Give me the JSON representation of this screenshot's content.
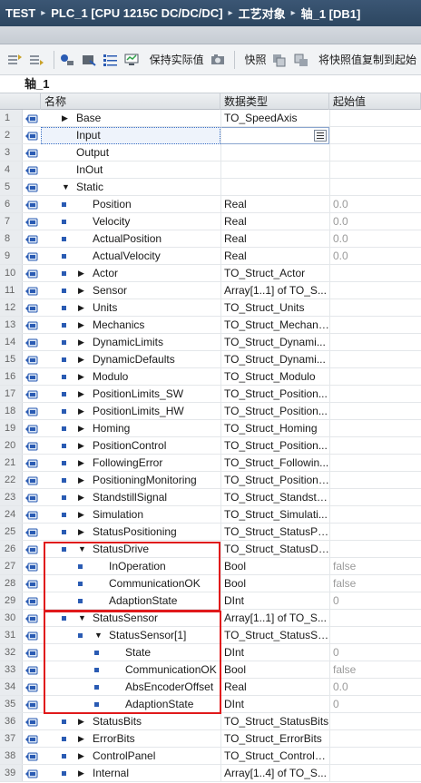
{
  "breadcrumb": {
    "project": "TEST",
    "plc": "PLC_1 [CPU 1215C DC/DC/DC]",
    "folder": "工艺对象",
    "block": "轴_1 [DB1]",
    "separator": "▸"
  },
  "toolbar": {
    "keep_actual": "保持实际值",
    "snapshot": "快照",
    "copy_snapshot": "将快照值复制到起始"
  },
  "block_title": "轴_1",
  "columns": {
    "name": "名称",
    "datatype": "数据类型",
    "start": "起始值"
  },
  "rows": [
    {
      "n": "1",
      "name": "Base",
      "type": "TO_SpeedAxis",
      "val": "",
      "arrow": "right",
      "dot": false,
      "indent": 0
    },
    {
      "n": "2",
      "name": "Input",
      "type": "",
      "val": "",
      "arrow": "none",
      "dot": false,
      "indent": 0
    },
    {
      "n": "3",
      "name": "Output",
      "type": "",
      "val": "",
      "arrow": "none",
      "dot": false,
      "indent": 0
    },
    {
      "n": "4",
      "name": "InOut",
      "type": "",
      "val": "",
      "arrow": "none",
      "dot": false,
      "indent": 0
    },
    {
      "n": "5",
      "name": "Static",
      "type": "",
      "val": "",
      "arrow": "down",
      "dot": false,
      "indent": 0
    },
    {
      "n": "6",
      "name": "Position",
      "type": "Real",
      "val": "0.0",
      "arrow": "none",
      "dot": true,
      "indent": 1
    },
    {
      "n": "7",
      "name": "Velocity",
      "type": "Real",
      "val": "0.0",
      "arrow": "none",
      "dot": true,
      "indent": 1
    },
    {
      "n": "8",
      "name": "ActualPosition",
      "type": "Real",
      "val": "0.0",
      "arrow": "none",
      "dot": true,
      "indent": 1
    },
    {
      "n": "9",
      "name": "ActualVelocity",
      "type": "Real",
      "val": "0.0",
      "arrow": "none",
      "dot": true,
      "indent": 1
    },
    {
      "n": "10",
      "name": "Actor",
      "type": "TO_Struct_Actor",
      "val": "",
      "arrow": "right",
      "dot": true,
      "indent": 1
    },
    {
      "n": "11",
      "name": "Sensor",
      "type": "Array[1..1] of TO_S...",
      "val": "",
      "arrow": "right",
      "dot": true,
      "indent": 1
    },
    {
      "n": "12",
      "name": "Units",
      "type": "TO_Struct_Units",
      "val": "",
      "arrow": "right",
      "dot": true,
      "indent": 1
    },
    {
      "n": "13",
      "name": "Mechanics",
      "type": "TO_Struct_Mechani...",
      "val": "",
      "arrow": "right",
      "dot": true,
      "indent": 1
    },
    {
      "n": "14",
      "name": "DynamicLimits",
      "type": "TO_Struct_Dynami...",
      "val": "",
      "arrow": "right",
      "dot": true,
      "indent": 1
    },
    {
      "n": "15",
      "name": "DynamicDefaults",
      "type": "TO_Struct_Dynami...",
      "val": "",
      "arrow": "right",
      "dot": true,
      "indent": 1
    },
    {
      "n": "16",
      "name": "Modulo",
      "type": "TO_Struct_Modulo",
      "val": "",
      "arrow": "right",
      "dot": true,
      "indent": 1
    },
    {
      "n": "17",
      "name": "PositionLimits_SW",
      "type": "TO_Struct_Position...",
      "val": "",
      "arrow": "right",
      "dot": true,
      "indent": 1
    },
    {
      "n": "18",
      "name": "PositionLimits_HW",
      "type": "TO_Struct_Position...",
      "val": "",
      "arrow": "right",
      "dot": true,
      "indent": 1
    },
    {
      "n": "19",
      "name": "Homing",
      "type": "TO_Struct_Homing",
      "val": "",
      "arrow": "right",
      "dot": true,
      "indent": 1
    },
    {
      "n": "20",
      "name": "PositionControl",
      "type": "TO_Struct_Position...",
      "val": "",
      "arrow": "right",
      "dot": true,
      "indent": 1
    },
    {
      "n": "21",
      "name": "FollowingError",
      "type": "TO_Struct_Followin...",
      "val": "",
      "arrow": "right",
      "dot": true,
      "indent": 1
    },
    {
      "n": "22",
      "name": "PositioningMonitoring",
      "type": "TO_Struct_Positioni...",
      "val": "",
      "arrow": "right",
      "dot": true,
      "indent": 1
    },
    {
      "n": "23",
      "name": "StandstillSignal",
      "type": "TO_Struct_Standstil...",
      "val": "",
      "arrow": "right",
      "dot": true,
      "indent": 1
    },
    {
      "n": "24",
      "name": "Simulation",
      "type": "TO_Struct_Simulati...",
      "val": "",
      "arrow": "right",
      "dot": true,
      "indent": 1
    },
    {
      "n": "25",
      "name": "StatusPositioning",
      "type": "TO_Struct_StatusPo...",
      "val": "",
      "arrow": "right",
      "dot": true,
      "indent": 1
    },
    {
      "n": "26",
      "name": "StatusDrive",
      "type": "TO_Struct_StatusDr...",
      "val": "",
      "arrow": "down",
      "dot": true,
      "indent": 1
    },
    {
      "n": "27",
      "name": "InOperation",
      "type": "Bool",
      "val": "false",
      "arrow": "none",
      "dot": true,
      "indent": 2
    },
    {
      "n": "28",
      "name": "CommunicationOK",
      "type": "Bool",
      "val": "false",
      "arrow": "none",
      "dot": true,
      "indent": 2
    },
    {
      "n": "29",
      "name": "AdaptionState",
      "type": "DInt",
      "val": "0",
      "arrow": "none",
      "dot": true,
      "indent": 2
    },
    {
      "n": "30",
      "name": "StatusSensor",
      "type": "Array[1..1] of TO_S...",
      "val": "",
      "arrow": "down",
      "dot": true,
      "indent": 1
    },
    {
      "n": "31",
      "name": "StatusSensor[1]",
      "type": "TO_Struct_StatusSe...",
      "val": "",
      "arrow": "down",
      "dot": true,
      "indent": 2
    },
    {
      "n": "32",
      "name": "State",
      "type": "DInt",
      "val": "0",
      "arrow": "none",
      "dot": true,
      "indent": 3
    },
    {
      "n": "33",
      "name": "CommunicationOK",
      "type": "Bool",
      "val": "false",
      "arrow": "none",
      "dot": true,
      "indent": 3
    },
    {
      "n": "34",
      "name": "AbsEncoderOffset",
      "type": "Real",
      "val": "0.0",
      "arrow": "none",
      "dot": true,
      "indent": 3
    },
    {
      "n": "35",
      "name": "AdaptionState",
      "type": "DInt",
      "val": "0",
      "arrow": "none",
      "dot": true,
      "indent": 3
    },
    {
      "n": "36",
      "name": "StatusBits",
      "type": "TO_Struct_StatusBits",
      "val": "",
      "arrow": "right",
      "dot": true,
      "indent": 1
    },
    {
      "n": "37",
      "name": "ErrorBits",
      "type": "TO_Struct_ErrorBits",
      "val": "",
      "arrow": "right",
      "dot": true,
      "indent": 1
    },
    {
      "n": "38",
      "name": "ControlPanel",
      "type": "TO_Struct_ControlP...",
      "val": "",
      "arrow": "right",
      "dot": true,
      "indent": 1
    },
    {
      "n": "39",
      "name": "Internal",
      "type": "Array[1..4] of TO_S...",
      "val": "",
      "arrow": "right",
      "dot": true,
      "indent": 1
    }
  ],
  "selected_row": "2",
  "colors": {
    "highlight": "#e0191b",
    "dot": "#2a5bb3",
    "titlebar": "#2c4660"
  }
}
